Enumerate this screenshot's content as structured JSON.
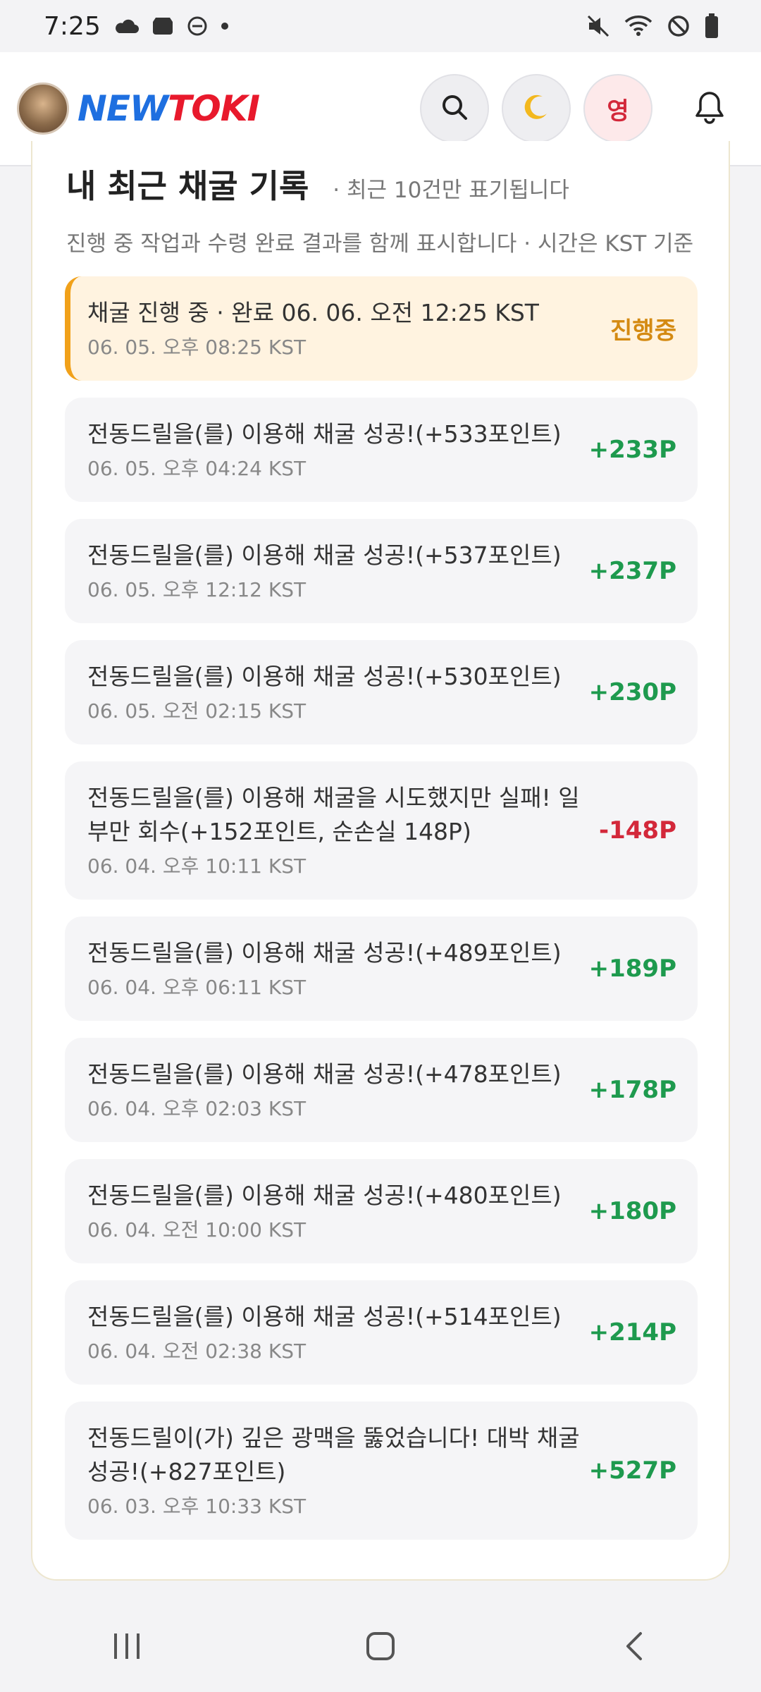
{
  "status_bar": {
    "time": "7:25",
    "left_icons": [
      "cloud-icon",
      "shield-icon",
      "dnd-icon",
      "dot-icon"
    ],
    "right_icons": [
      "mute-icon",
      "wifi-icon",
      "blocked-icon",
      "battery-icon"
    ]
  },
  "header": {
    "logo_part1": "NEW",
    "logo_part2": "TOKI",
    "language_label": "영",
    "colors": {
      "brand_blue": "#1e6fe0",
      "brand_red": "#e8192c"
    }
  },
  "card": {
    "title": "내 최근 채굴 기록",
    "subnote": "· 최근 10건만 표기됩니다",
    "description": "진행 중 작업과 수령 완료 결과를 함께 표시합니다 · 시간은 KST 기준"
  },
  "entries": [
    {
      "message": "채굴 진행 중 · 완료 06. 06. 오전 12:25 KST",
      "time": "06. 05. 오후 08:25 KST",
      "amount": "진행중",
      "status": "progress"
    },
    {
      "message": "전동드릴을(를) 이용해 채굴 성공!(+533포인트)",
      "time": "06. 05. 오후 04:24 KST",
      "amount": "+233P",
      "status": "positive"
    },
    {
      "message": "전동드릴을(를) 이용해 채굴 성공!(+537포인트)",
      "time": "06. 05. 오후 12:12 KST",
      "amount": "+237P",
      "status": "positive"
    },
    {
      "message": "전동드릴을(를) 이용해 채굴 성공!(+530포인트)",
      "time": "06. 05. 오전 02:15 KST",
      "amount": "+230P",
      "status": "positive"
    },
    {
      "message": "전동드릴을(를) 이용해 채굴을 시도했지만 실패! 일부만 회수(+152포인트, 순손실 148P)",
      "time": "06. 04. 오후 10:11 KST",
      "amount": "-148P",
      "status": "negative"
    },
    {
      "message": "전동드릴을(를) 이용해 채굴 성공!(+489포인트)",
      "time": "06. 04. 오후 06:11 KST",
      "amount": "+189P",
      "status": "positive"
    },
    {
      "message": "전동드릴을(를) 이용해 채굴 성공!(+478포인트)",
      "time": "06. 04. 오후 02:03 KST",
      "amount": "+178P",
      "status": "positive"
    },
    {
      "message": "전동드릴을(를) 이용해 채굴 성공!(+480포인트)",
      "time": "06. 04. 오전 10:00 KST",
      "amount": "+180P",
      "status": "positive"
    },
    {
      "message": "전동드릴을(를) 이용해 채굴 성공!(+514포인트)",
      "time": "06. 04. 오전 02:38 KST",
      "amount": "+214P",
      "status": "positive"
    },
    {
      "message": "전동드릴이(가) 깊은 광맥을 뚫었습니다! 대박 채굴 성공!(+827포인트)",
      "time": "06. 03. 오후 10:33 KST",
      "amount": "+527P",
      "status": "positive"
    }
  ],
  "nav_bar": {
    "buttons": [
      "recents-icon",
      "home-icon",
      "back-icon"
    ]
  }
}
